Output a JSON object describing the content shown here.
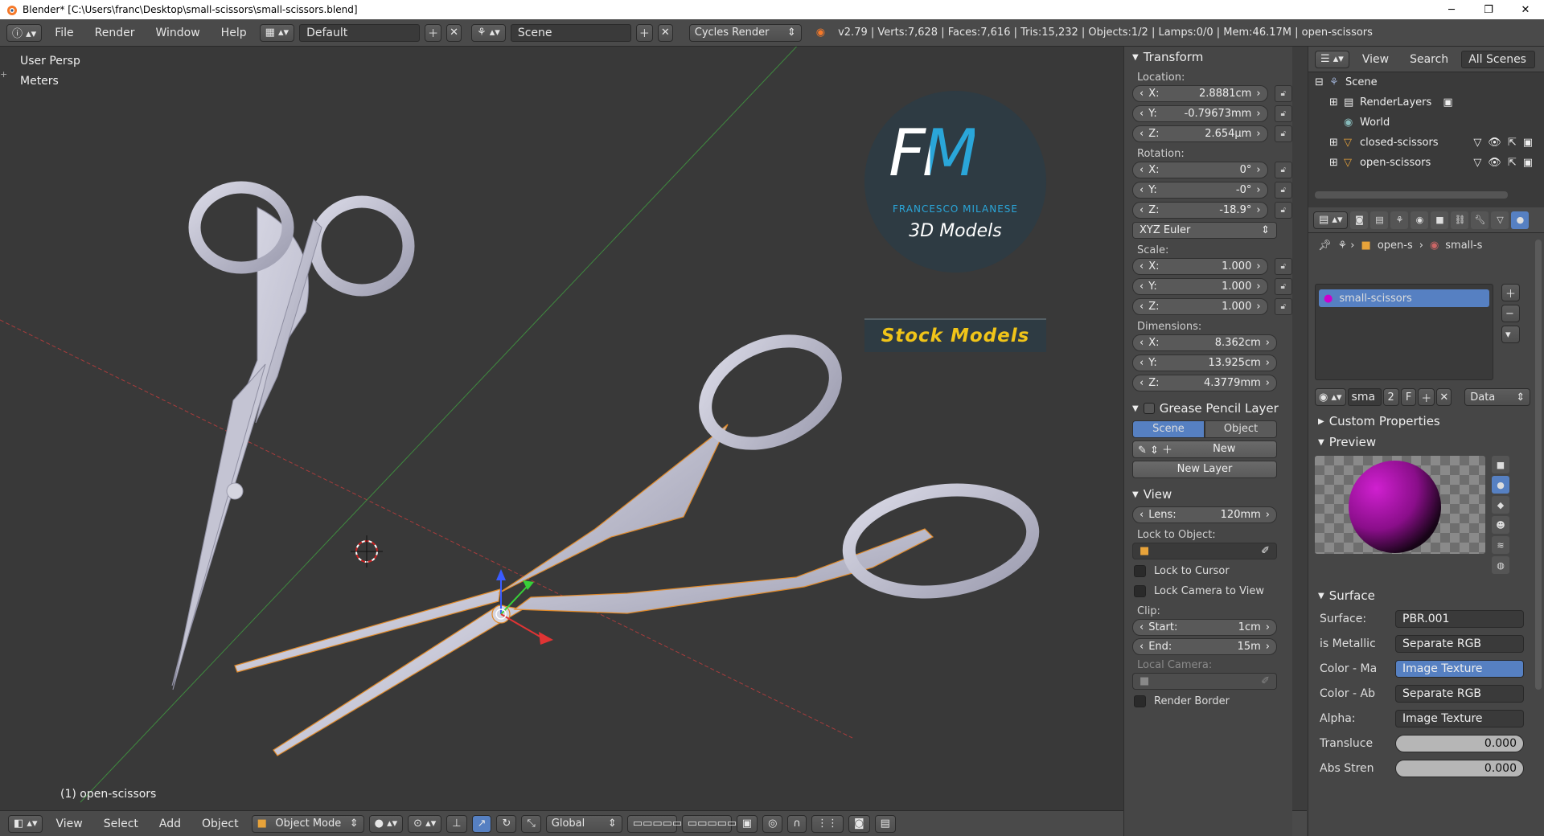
{
  "window": {
    "title": "Blender* [C:\\Users\\franc\\Desktop\\small-scissors\\small-scissors.blend]",
    "min": "─",
    "max": "❐",
    "close": "✕"
  },
  "info_header": {
    "menus": [
      "File",
      "Render",
      "Window",
      "Help"
    ],
    "layout": "Default",
    "scene": "Scene",
    "engine": "Cycles Render",
    "stats": "v2.79 | Verts:7,628 | Faces:7,616 | Tris:15,232 | Objects:1/2 | Lamps:0/0 | Mem:46.17M | open-scissors"
  },
  "viewport": {
    "view_name": "User Persp",
    "units": "Meters",
    "object_label": "(1) open-scissors"
  },
  "logo": {
    "initials": "FM",
    "author": "FRANCESCO MILANESE",
    "subtitle": "3D Models",
    "banner": "Stock Models"
  },
  "colors": {
    "accent_blue": "#5680c2",
    "logo_cyan": "#2aa6d9",
    "logo_banner": "#f0c419",
    "viewport_bg": "#393939"
  },
  "bottom_header": {
    "menus": [
      "View",
      "Select",
      "Add",
      "Object"
    ],
    "mode": "Object Mode",
    "orientation": "Global"
  },
  "npanel": {
    "transform_title": "Transform",
    "location_label": "Location:",
    "location": [
      {
        "axis": "X:",
        "value": "2.8881cm"
      },
      {
        "axis": "Y:",
        "value": "-0.79673mm"
      },
      {
        "axis": "Z:",
        "value": "2.654μm"
      }
    ],
    "rotation_label": "Rotation:",
    "rotation": [
      {
        "axis": "X:",
        "value": "0°"
      },
      {
        "axis": "Y:",
        "value": "-0°"
      },
      {
        "axis": "Z:",
        "value": "-18.9°"
      }
    ],
    "rotation_mode": "XYZ Euler",
    "scale_label": "Scale:",
    "scale": [
      {
        "axis": "X:",
        "value": "1.000"
      },
      {
        "axis": "Y:",
        "value": "1.000"
      },
      {
        "axis": "Z:",
        "value": "1.000"
      }
    ],
    "dimensions_label": "Dimensions:",
    "dimensions": [
      {
        "axis": "X:",
        "value": "8.362cm"
      },
      {
        "axis": "Y:",
        "value": "13.925cm"
      },
      {
        "axis": "Z:",
        "value": "4.3779mm"
      }
    ],
    "grease_title": "Grease Pencil Layer",
    "grease_scene": "Scene",
    "grease_object": "Object",
    "grease_new": "New",
    "grease_new_layer": "New Layer",
    "view_title": "View",
    "lens_label": "Lens:",
    "lens_value": "120mm",
    "lock_object_label": "Lock to Object:",
    "lock_cursor": "Lock to Cursor",
    "lock_camera": "Lock Camera to View",
    "clip_label": "Clip:",
    "clip_start_label": "Start:",
    "clip_start": "1cm",
    "clip_end_label": "End:",
    "clip_end": "15m",
    "local_camera_label": "Local Camera:",
    "render_border": "Render Border"
  },
  "outliner": {
    "menus": [
      "View",
      "Search"
    ],
    "filter": "All Scenes",
    "items": [
      {
        "label": "Scene",
        "indent": 0
      },
      {
        "label": "RenderLayers",
        "indent": 1
      },
      {
        "label": "World",
        "indent": 1
      },
      {
        "label": "closed-scissors",
        "indent": 1
      },
      {
        "label": "open-scissors",
        "indent": 1
      }
    ]
  },
  "properties": {
    "breadcrumb": [
      "open-s",
      "small-s"
    ],
    "material_slot": "small-scissors",
    "mat_name": "sma",
    "mat_users": "2",
    "mat_fake": "F",
    "link": "Data",
    "custom_props": "Custom Properties",
    "preview": "Preview",
    "surface_title": "Surface",
    "surface_rows": [
      {
        "label": "Surface:",
        "value": "PBR.001",
        "style": ""
      },
      {
        "label": "is Metallic",
        "value": "Separate RGB",
        "style": ""
      },
      {
        "label": "Color - Ma",
        "value": "Image Texture",
        "style": "hl"
      },
      {
        "label": "Color - Ab",
        "value": "Separate RGB",
        "style": ""
      },
      {
        "label": "Alpha:",
        "value": "Image Texture",
        "style": ""
      },
      {
        "label": "Transluce",
        "value": "0.000",
        "style": "slider"
      },
      {
        "label": "Abs Stren",
        "value": "0.000",
        "style": "slider"
      }
    ]
  }
}
